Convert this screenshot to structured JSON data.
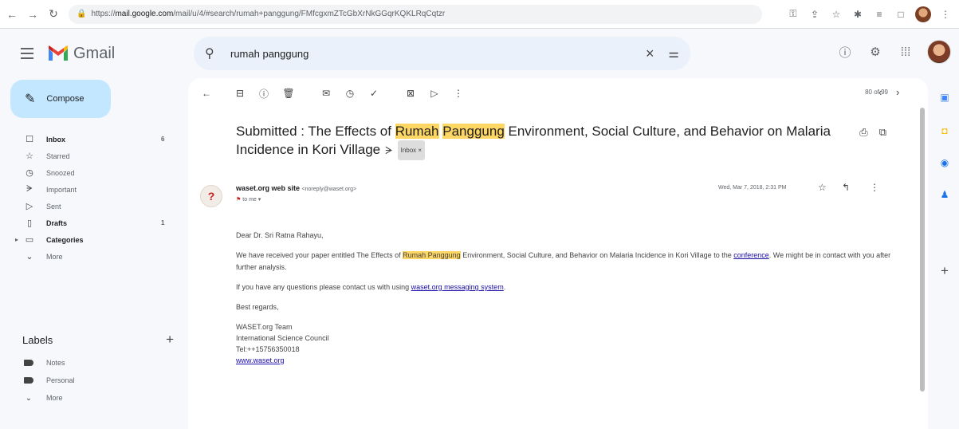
{
  "browser": {
    "url_prefix": "https://",
    "url_host": "mail.google.com",
    "url_rest": "/mail/u/4/#search/rumah+panggung/FMfcgxmZTcGbXrNkGGqrKQKLRqCqtzr"
  },
  "app": {
    "name": "Gmail"
  },
  "search": {
    "query": "rumah panggung"
  },
  "compose": {
    "label": "Compose"
  },
  "nav": [
    {
      "label": "Inbox",
      "icon": "inbox-icon",
      "glyph": "☐",
      "bold": true,
      "count": "6"
    },
    {
      "label": "Starred",
      "icon": "star-icon",
      "glyph": "☆",
      "bold": false,
      "count": ""
    },
    {
      "label": "Snoozed",
      "icon": "clock-icon",
      "glyph": "◷",
      "bold": false,
      "count": ""
    },
    {
      "label": "Important",
      "icon": "important-icon",
      "glyph": "ᗒ",
      "bold": false,
      "count": ""
    },
    {
      "label": "Sent",
      "icon": "send-icon",
      "glyph": "▷",
      "bold": false,
      "count": ""
    },
    {
      "label": "Drafts",
      "icon": "draft-icon",
      "glyph": "▯",
      "bold": true,
      "count": "1"
    },
    {
      "label": "Categories",
      "icon": "label-outline-icon",
      "glyph": "▭",
      "bold": true,
      "count": ""
    },
    {
      "label": "More",
      "icon": "chevron-down-icon",
      "glyph": "⌄",
      "bold": false,
      "count": ""
    }
  ],
  "labels": {
    "heading": "Labels",
    "items": [
      {
        "label": "Notes"
      },
      {
        "label": "Personal"
      }
    ],
    "more": "More"
  },
  "pager": {
    "text": "80 of 99"
  },
  "email": {
    "subject_pre": "Submitted : The Effects of ",
    "subject_hl1": "Rumah",
    "subject_hl2": "Panggung",
    "subject_post": " Environment, Social Culture, and Behavior on Malaria Incidence in Kori Village",
    "label_chip": "Inbox ×",
    "sender_name": "waset.org web site",
    "sender_email": "<noreply@waset.org>",
    "to": "to me ▾",
    "date": "Wed, Mar 7, 2018, 2:31 PM",
    "greeting": "Dear Dr. Sri Ratna Rahayu,",
    "p1_pre": "We have received your paper entitled The Effects of ",
    "p1_hl": "Rumah Panggung",
    "p1_post": " Environment, Social Culture, and Behavior on Malaria Incidence in Kori Village to the ",
    "p1_link": "conference",
    "p1_end": ". We might be in contact with you after further analysis.",
    "p2_pre": "If you have any questions please contact us with using ",
    "p2_link": "waset.org messaging system",
    "p2_end": ".",
    "closing": "Best regards,",
    "sig1": "WASET.org Team",
    "sig2": "International Science Council",
    "sig3": "Tel:++15756350018",
    "sig4": "www.waset.org"
  },
  "colors": {
    "highlight": "#fdd663",
    "compose_bg": "#c2e7ff",
    "search_bg": "#eaf1fb",
    "link": "#1a0dab"
  }
}
